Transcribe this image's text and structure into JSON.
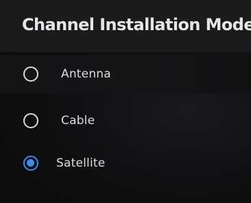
{
  "header": {
    "title": "Channel Installation Mode"
  },
  "options": [
    {
      "label": "Antenna",
      "selected": false
    },
    {
      "label": "Cable",
      "selected": false
    },
    {
      "label": "Satellite",
      "selected": true
    }
  ],
  "colors": {
    "accent": "#3c8df0",
    "background": "#0b0b0d",
    "header_bg": "#1b1b1e",
    "text": "#e6e6e8"
  },
  "icons": {
    "unselected": "radio-unchecked-icon",
    "selected": "radio-checked-icon"
  }
}
